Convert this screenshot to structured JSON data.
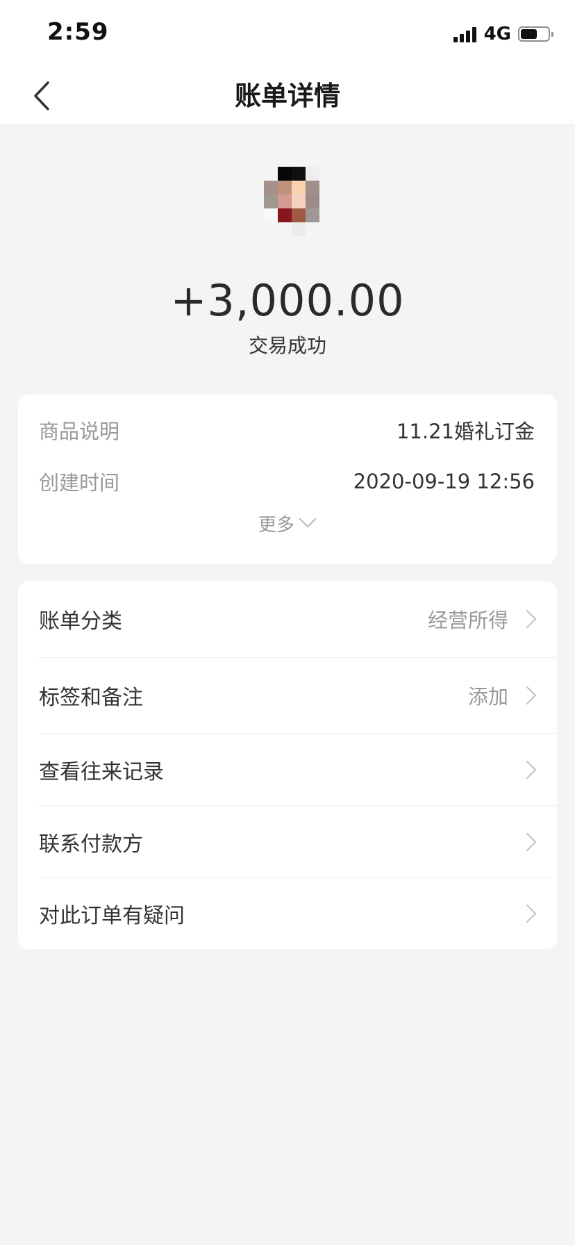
{
  "status_bar": {
    "time": "2:59",
    "network": "4G",
    "signal_bars": 4,
    "battery_level": 0.6
  },
  "nav": {
    "title": "账单详情"
  },
  "transaction": {
    "amount": "+3,000.00",
    "status": "交易成功"
  },
  "details": {
    "rows": [
      {
        "label": "商品说明",
        "value": "11.21婚礼订金"
      },
      {
        "label": "创建时间",
        "value": "2020-09-19 12:56"
      }
    ],
    "more_label": "更多"
  },
  "menu": {
    "items": [
      {
        "label": "账单分类",
        "value": "经营所得"
      },
      {
        "label": "标签和备注",
        "value": "添加"
      },
      {
        "label": "查看往来记录",
        "value": ""
      },
      {
        "label": "联系付款方",
        "value": ""
      },
      {
        "label": "对此订单有疑问",
        "value": ""
      }
    ]
  },
  "colors": {
    "background": "#f4f4f4",
    "card": "#ffffff",
    "primary_text": "#333333",
    "secondary_text": "#999999",
    "divider": "#eeeeee"
  }
}
